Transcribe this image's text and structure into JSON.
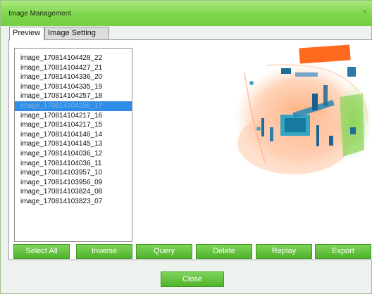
{
  "window": {
    "title": "Image Management",
    "close_glyph": "×"
  },
  "tabs": [
    {
      "label": "Preview",
      "active": true
    },
    {
      "label": "Image Setting",
      "active": false
    }
  ],
  "image_list": {
    "items": [
      "image_170814104428_22",
      "image_170814104427_21",
      "image_170814104336_20",
      "image_170814104335_19",
      "image_170814104257_18",
      "image_170814104256_17",
      "image_170814104217_16",
      "image_170814104217_15",
      "image_170814104146_14",
      "image_170814104145_13",
      "image_170814104036_12",
      "image_170814104036_11",
      "image_170814103957_10",
      "image_170814103956_09",
      "image_170814103824_08",
      "image_170814103823_07"
    ],
    "selected_index": 5
  },
  "buttons": {
    "select_all": "Select All",
    "inverse": "Inverse",
    "query": "Query",
    "delete": "Delete",
    "replay": "Replay",
    "export": "Export"
  },
  "footer": {
    "close_label": "Close"
  },
  "colors": {
    "accent": "#5cbf36",
    "titlebar": "#7fd64d",
    "selection": "#2f8de6"
  },
  "icons": {
    "window_close": "close-icon"
  }
}
